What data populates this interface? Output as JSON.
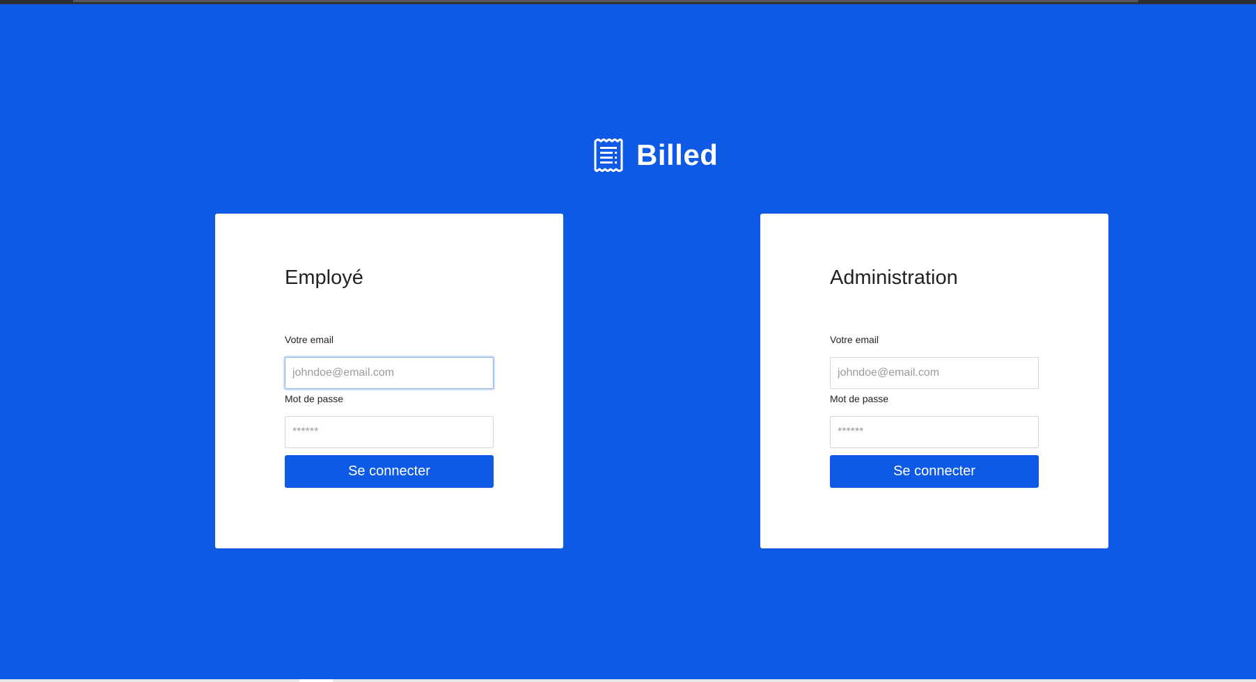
{
  "app": {
    "name": "Billed",
    "logo_icon": "receipt-icon",
    "brand_color": "#0e5ae5"
  },
  "employee_form": {
    "title": "Employé",
    "email_label": "Votre email",
    "email_placeholder": "johndoe@email.com",
    "email_value": "",
    "password_label": "Mot de passe",
    "password_placeholder": "******",
    "password_value": "",
    "submit_label": "Se connecter"
  },
  "admin_form": {
    "title": "Administration",
    "email_label": "Votre email",
    "email_placeholder": "johndoe@email.com",
    "email_value": "",
    "password_label": "Mot de passe",
    "password_placeholder": "******",
    "password_value": "",
    "submit_label": "Se connecter"
  }
}
